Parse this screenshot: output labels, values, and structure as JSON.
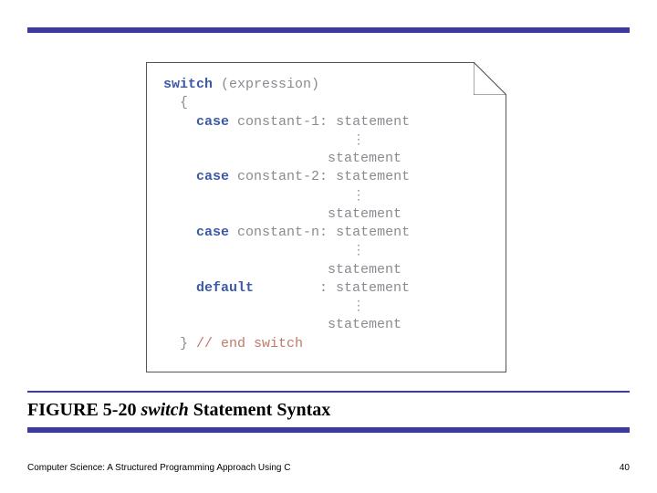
{
  "code": {
    "kw_switch": "switch",
    "expr": " (expression)",
    "open_brace": "  {",
    "kw_case": "case",
    "const1": " constant-1: ",
    "const2": " constant-2: ",
    "constn": " constant-n: ",
    "kw_default": "default",
    "default_pad": "        : ",
    "stmt": "statement",
    "close_brace": "  }",
    "comment": " // end switch",
    "indent_case": "    ",
    "indent_stmt": "                    ",
    "indent_vell": "                       "
  },
  "caption": {
    "fignum": "FIGURE 5-20",
    "kw": "switch",
    "rest": " Statement Syntax"
  },
  "footer": {
    "left": "Computer Science: A Structured Programming Approach Using C",
    "right": "40"
  }
}
